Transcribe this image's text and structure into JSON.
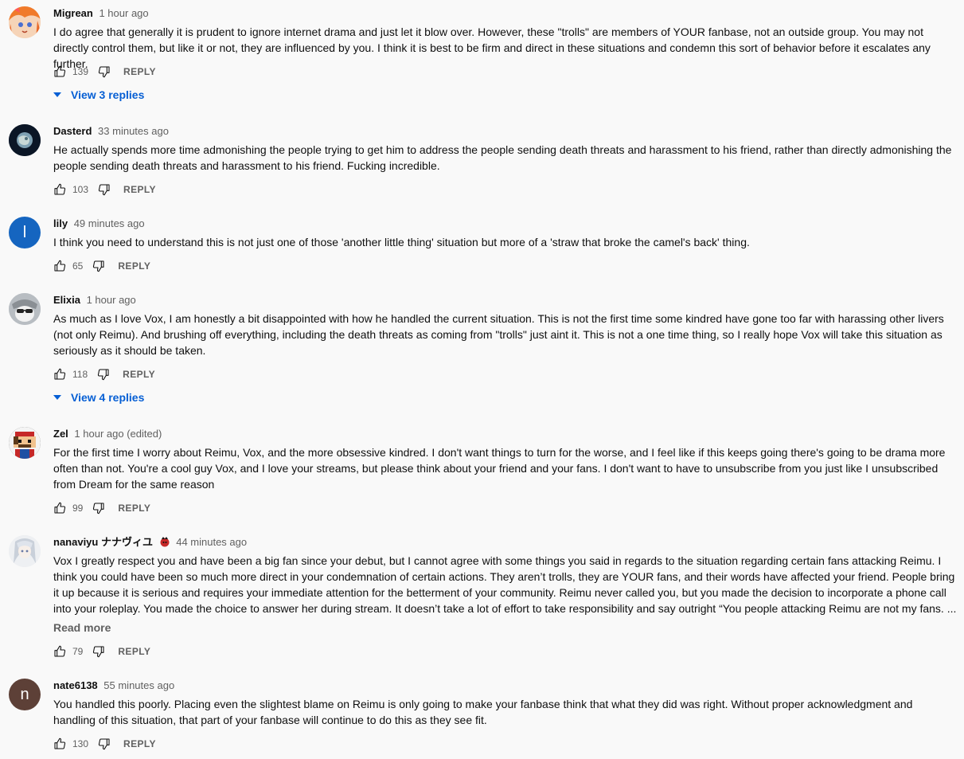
{
  "comments": [
    {
      "author": "Migrean",
      "time": "1 hour ago",
      "text": "I do agree that generally it is prudent to ignore internet drama and just let it blow over. However, these \"trolls\" are members of YOUR fanbase, not an outside group. You may not directly control them, but like it or not, they are influenced by you. I think it is best to be firm and direct in these situations and condemn this sort of behavior before it escalates any further.",
      "likes": "139",
      "reply": "REPLY",
      "view_replies": "View 3 replies",
      "avatar_color": "#f08a3c"
    },
    {
      "author": "Dasterd",
      "time": "33 minutes ago",
      "text": "He actually spends more time admonishing the people trying to get him to address the people sending death threats and harassment to his friend, rather than directly admonishing the people sending death threats and harassment to his friend. Fucking incredible.",
      "likes": "103",
      "reply": "REPLY",
      "avatar_color": "#0d1a2e"
    },
    {
      "author": "lily",
      "time": "49 minutes ago",
      "text": "I think you need to understand this is not just one of those 'another little thing' situation but more of a 'straw that broke the camel's back' thing.",
      "likes": "65",
      "reply": "REPLY",
      "avatar_letter": "l",
      "avatar_color": "#1565c0"
    },
    {
      "author": "Elixia",
      "time": "1 hour ago",
      "text": "As much as I love Vox, I am honestly a bit disappointed with how he handled the current situation. This is not the first time some kindred have gone too far with harassing other livers (not only Reimu). And brushing off everything, including the death threats as coming from \"trolls\" just aint it. This is not a one time thing, so I really hope Vox will take this situation as seriously as it should be taken.",
      "likes": "118",
      "reply": "REPLY",
      "view_replies": "View 4 replies",
      "avatar_color": "#b9bcc0"
    },
    {
      "author": "Zel",
      "time": "1 hour ago (edited)",
      "text": "For the first time I worry about Reimu, Vox, and the more obsessive kindred. I don't want things to turn for the worse, and I feel like if this keeps going there's going to be drama more often than not. You're a cool guy Vox, and I love your streams, but please think about your friend and your fans. I don't want to have to unsubscribe from you just like I unsubscribed from Dream for the same reason",
      "likes": "99",
      "reply": "REPLY",
      "avatar_color": "#2b2b2b"
    },
    {
      "author": "nanaviyu ナナヴィユ",
      "time": "44 minutes ago",
      "text": "Vox I greatly respect you and have been a big fan since your debut, but I cannot agree with some things you said in regards to the situation regarding certain fans attacking Reimu. I think you could have been so much more direct in your condemnation of certain actions. They aren’t trolls, they are YOUR fans, and their words have affected your friend. People bring it up because it is serious and requires your immediate attention for the betterment of your community. Reimu never called you, but you made the decision to incorporate a phone call into your roleplay. You made the choice to answer her during stream. It doesn’t take a lot of effort to take responsibility and say outright “You people attacking Reimu are not my fans. ...",
      "read_more": "Read more",
      "likes": "79",
      "reply": "REPLY",
      "avatar_color": "#e4e6ea"
    },
    {
      "author": "nate6138",
      "time": "55 minutes ago",
      "text": "You handled this poorly. Placing even the slightest blame on Reimu is only going to make your fanbase think that what they did was right. Without proper acknowledgment and handling of this situation, that part of your fanbase will continue to do this as they see fit.",
      "likes": "130",
      "reply": "REPLY",
      "avatar_letter": "n",
      "avatar_color": "#5d4037"
    }
  ]
}
